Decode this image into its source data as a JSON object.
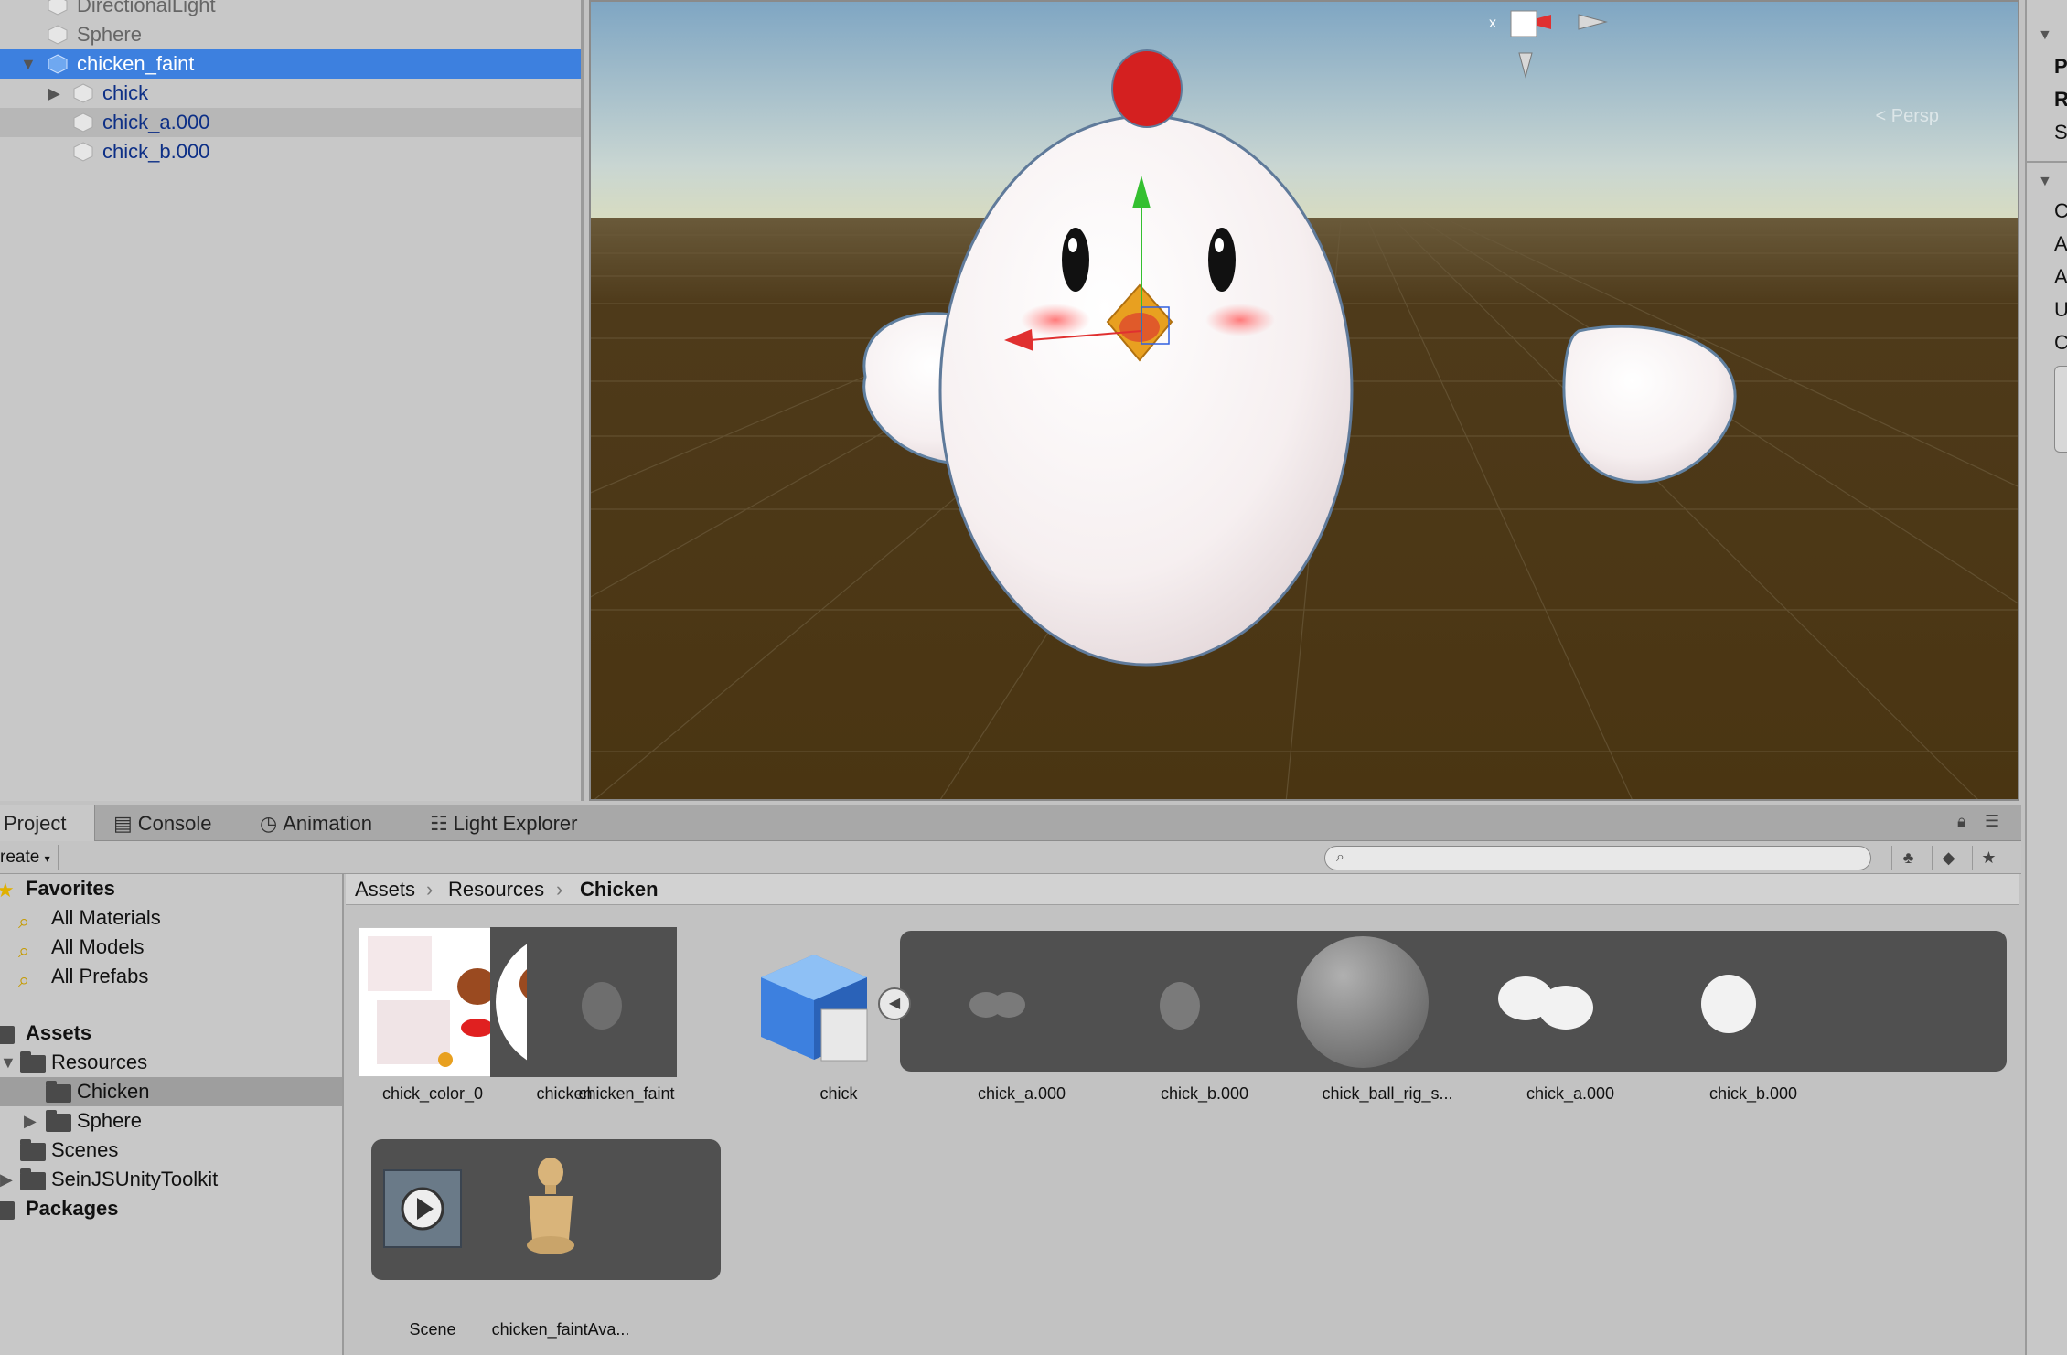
{
  "hierarchy": {
    "items": [
      {
        "label": "DirectionalLight"
      },
      {
        "label": "Sphere"
      },
      {
        "label": "chicken_faint"
      },
      {
        "label": "chick"
      },
      {
        "label": "chick_a.000"
      },
      {
        "label": "chick_b.000"
      }
    ]
  },
  "scene": {
    "persp_label": "< Persp",
    "gizmo_axis_label": "x"
  },
  "inspector": {
    "letters": [
      "P",
      "R",
      "S",
      "C",
      "A",
      "A",
      "U",
      "C"
    ]
  },
  "tabs": [
    {
      "label": "Project",
      "icon": "project-icon"
    },
    {
      "label": "Console",
      "icon": "console-icon"
    },
    {
      "label": "Animation",
      "icon": "clock-icon"
    },
    {
      "label": "Light Explorer",
      "icon": "sliders-icon"
    }
  ],
  "toolbar": {
    "create_label": "reate",
    "search_placeholder": ""
  },
  "folders": {
    "favorites_label": "Favorites",
    "favorites": [
      "All Materials",
      "All Models",
      "All Prefabs"
    ],
    "assets_label": "Assets",
    "resources_label": "Resources",
    "chicken_label": "Chicken",
    "sphere_label": "Sphere",
    "scenes_label": "Scenes",
    "toolkit_label": "SeinJSUnityToolkit",
    "packages_label": "Packages"
  },
  "breadcrumb": [
    "Assets",
    "Resources",
    "Chicken"
  ],
  "assets": {
    "row1": [
      "chick_color_0",
      "chicken",
      "chicken_faint",
      "chick",
      "chick_a.000",
      "chick_b.000",
      "chick_ball_rig_s...",
      "chick_a.000",
      "chick_b.000"
    ],
    "row2": [
      "Scene",
      "chicken_faintAva..."
    ]
  },
  "colors": {
    "selection": "#3d80df",
    "sky_top": "#8fb2c9",
    "ground": "#4e3a1a",
    "comb": "#d42020",
    "beak": "#e8a020"
  }
}
